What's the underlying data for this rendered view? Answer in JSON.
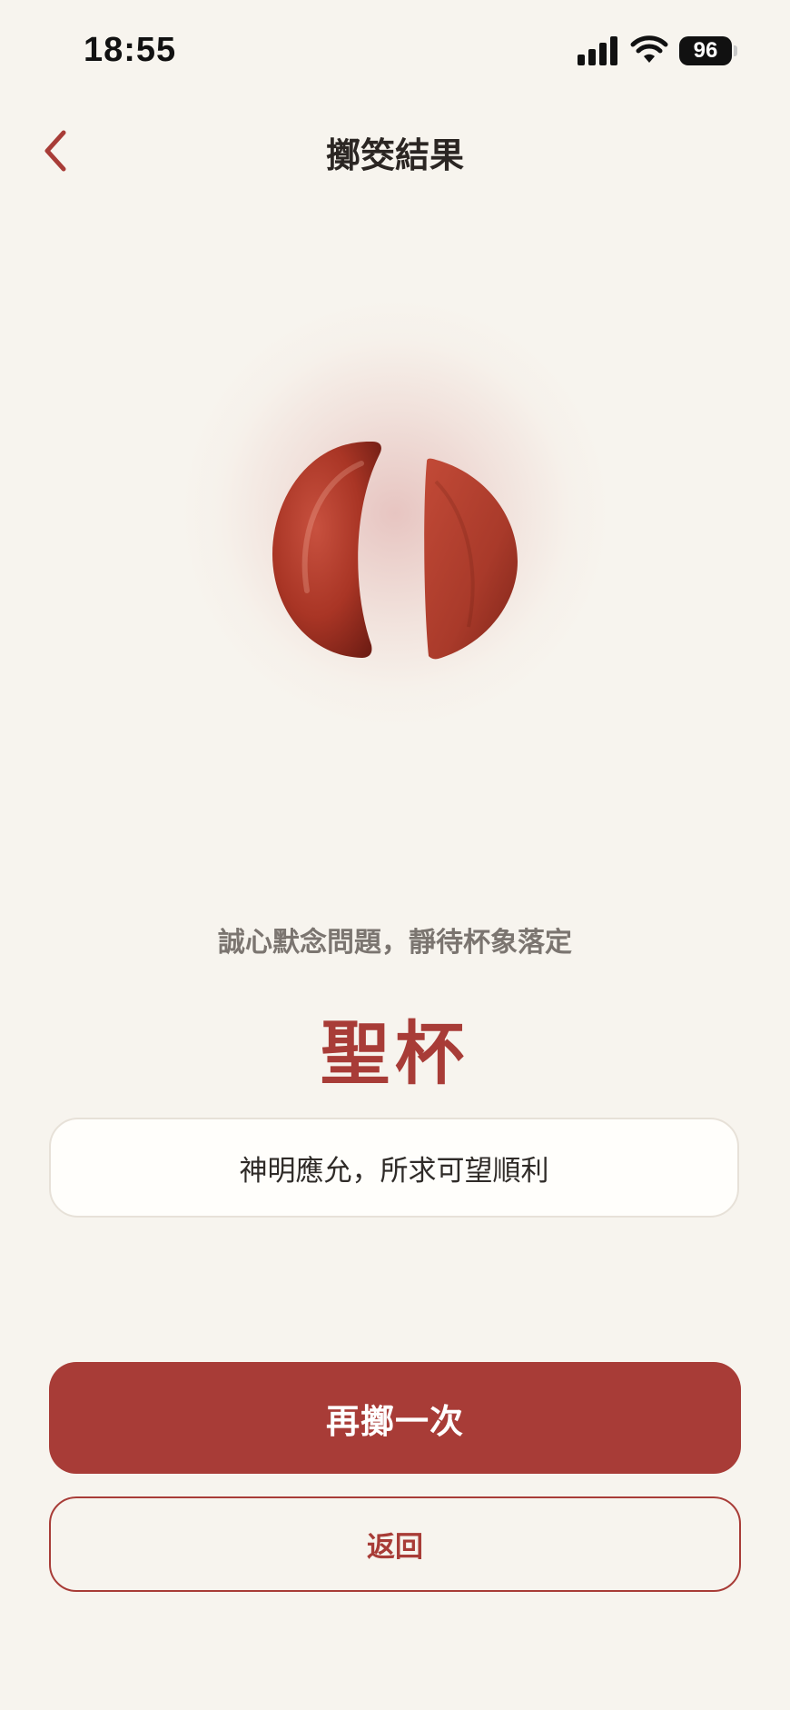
{
  "status_bar": {
    "time": "18:55",
    "battery": "96"
  },
  "header": {
    "title": "擲筊結果",
    "back_icon": "chevron-left-icon"
  },
  "illustration": {
    "subject": "jiaobei-blocks-icon",
    "color": "#b43a2e"
  },
  "result": {
    "prompt": "誠心默念問題，靜待杯象落定",
    "name": "聖杯",
    "meaning": "神明應允，所求可望順利"
  },
  "actions": {
    "throw_again_label": "再擲一次",
    "back_label": "返回"
  },
  "colors": {
    "accent": "#a83c37",
    "background": "#f7f4ee",
    "card_bg": "#fffefb"
  }
}
